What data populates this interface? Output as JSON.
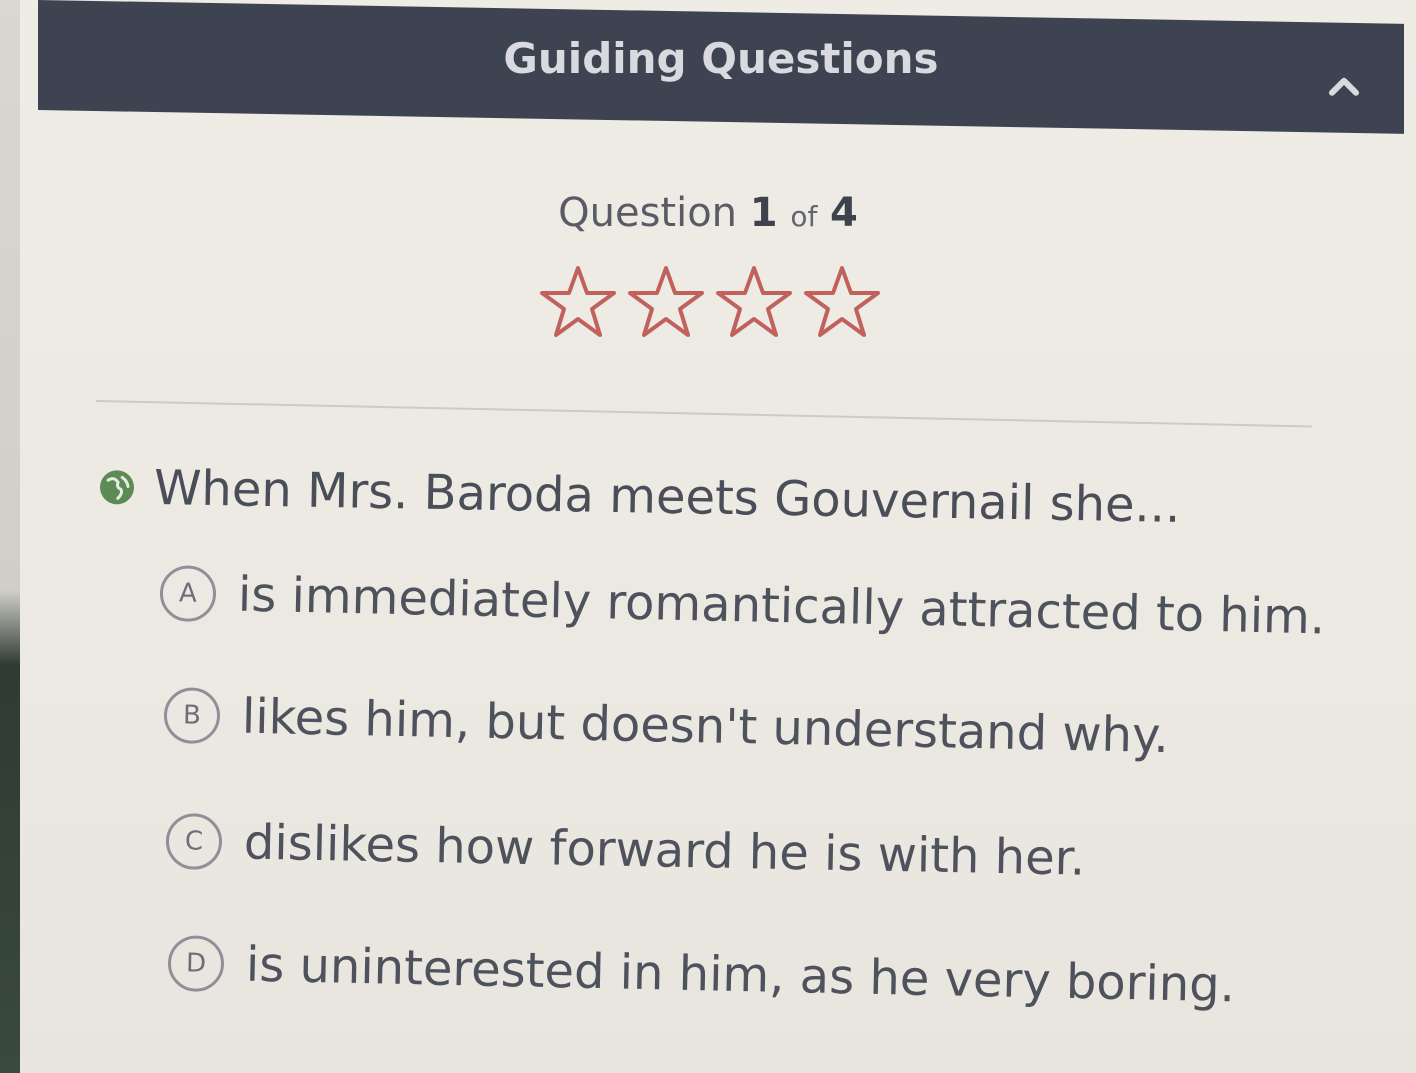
{
  "header": {
    "title": "Guiding Questions",
    "collapse_icon": "chevron-up-icon"
  },
  "progress": {
    "label": "Question",
    "current": "1",
    "of_label": "of",
    "total": "4"
  },
  "stars": {
    "count": 4,
    "filled": 0,
    "outline_color": "#c0615c"
  },
  "question": {
    "icon": "globe-icon",
    "icon_color": "#5d8a55",
    "text": "When Mrs. Baroda meets Gouvernail she..."
  },
  "options": [
    {
      "letter": "A",
      "text": "is immediately romantically attracted to him."
    },
    {
      "letter": "B",
      "text": "likes him, but doesn't understand why."
    },
    {
      "letter": "C",
      "text": "dislikes how forward he is with her."
    },
    {
      "letter": "D",
      "text": "is uninterested in him, as he very boring."
    }
  ],
  "colors": {
    "header_bg": "#3d4350",
    "page_bg": "#ece9e2"
  }
}
